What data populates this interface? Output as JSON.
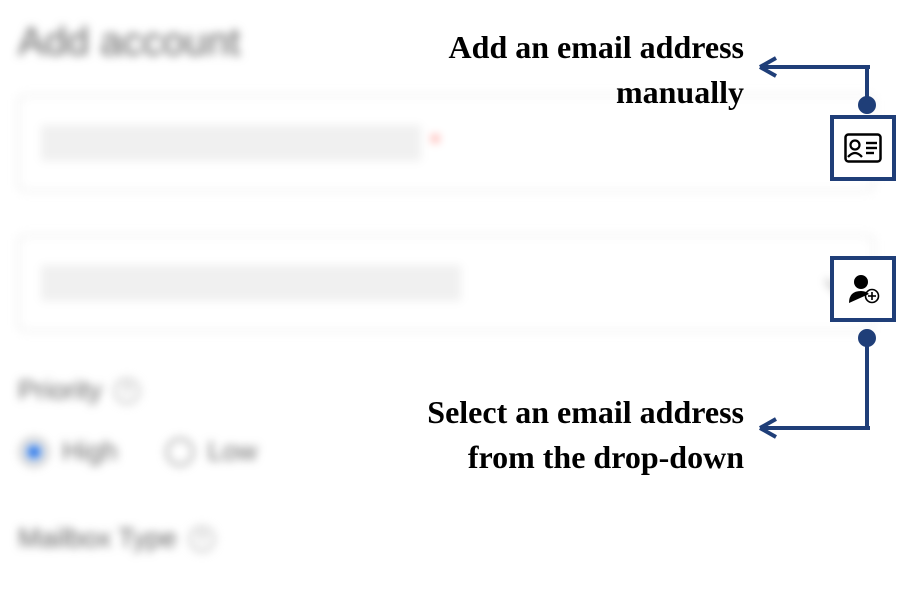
{
  "form": {
    "title": "Add account",
    "email_input_value": "",
    "email_required_mark": "*",
    "dropdown_selected": "",
    "priority_label": "Priority",
    "priority_help": "?",
    "priority_options": {
      "high": "High",
      "low": "Low"
    },
    "priority_selected": "high",
    "mailbox_type_label": "Mailbox Type",
    "mailbox_type_help": "?"
  },
  "annotations": {
    "manual_line1": "Add an email address",
    "manual_line2": "manually",
    "dropdown_line1": "Select an email address",
    "dropdown_line2": "from the drop-down"
  },
  "colors": {
    "annotation_border": "#1f3e78",
    "accent": "#1f6fe5"
  }
}
